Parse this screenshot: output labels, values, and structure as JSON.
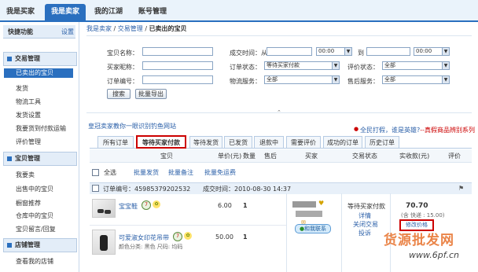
{
  "top_nav": {
    "tabs": [
      "我是买家",
      "我是卖家",
      "我的江湖",
      "账号管理"
    ]
  },
  "sidebar": {
    "quick_title": "快捷功能",
    "settings": "设置",
    "sections": [
      {
        "title": "交易管理",
        "items": [
          "已卖出的宝贝",
          "发货",
          "物流工具",
          "发货设置",
          "我要货到付款运输",
          "评价管理"
        ]
      },
      {
        "title": "宝贝管理",
        "items": [
          "我要卖",
          "出售中的宝贝",
          "橱窗推荐",
          "仓库中的宝贝",
          "宝贝留言/回复"
        ]
      },
      {
        "title": "店铺管理",
        "items": [
          "查看我的店铺"
        ]
      }
    ]
  },
  "breadcrumb": {
    "a": "我是卖家",
    "b": "交易管理",
    "c": "已卖出的宝贝"
  },
  "filters": {
    "item_name_label": "宝贝名称：",
    "deal_time_label": "成交时间：从",
    "to_label": "到",
    "time_value": "00:00",
    "buyer_label": "买家昵称：",
    "order_status_label": "订单状态：",
    "order_status_value": "等待买家付款",
    "review_status_label": "评价状态：",
    "review_status_value": "全部",
    "order_no_label": "订单编号：",
    "logistics_label": "物流服务：",
    "logistics_value": "全部",
    "aftersale_label": "售后服务：",
    "aftersale_value": "全部",
    "search_button": "搜索",
    "export_button": "批量导出"
  },
  "promo": {
    "left": "皇冠卖家教你一眼识别钓鱼网站",
    "right_a": "全民打假，谁是英雄?",
    "right_b": "--真假商品辨别系列"
  },
  "status_tabs": [
    "所有订单",
    "等待买家付款",
    "等待发货",
    "已发货",
    "退款中",
    "需要评价",
    "成功的订单",
    "历史订单"
  ],
  "columns": [
    "宝贝",
    "单价(元)",
    "数量",
    "售后",
    "买家",
    "交易状态",
    "实收款(元)",
    "评价"
  ],
  "bulk": {
    "select_all": "全选",
    "ship": "批量发货",
    "note": "批量备注",
    "free_ship": "批量免运费"
  },
  "order": {
    "order_no_label": "订单编号：",
    "order_no": "45985379202532",
    "time_label": "成交时间：",
    "time": "2010-08-30 14:37",
    "items": [
      {
        "name": "宝宝鞋",
        "price": "6.00",
        "qty": "1",
        "desc": ""
      },
      {
        "name": "可爱淑女印花吊带",
        "price": "50.00",
        "qty": "1",
        "desc": "颜色分类: 黑色   尺码: 均码"
      }
    ],
    "contact": "和我联系",
    "status": "等待买家付款",
    "status_links": [
      "详情",
      "关闭交易",
      "投诉"
    ],
    "total": "70.70",
    "shipping": "(含 快递 : 15.00)",
    "modify_price": "修改价格"
  },
  "watermark": {
    "text": "货源批发网",
    "url": "www.6pf.cn"
  }
}
